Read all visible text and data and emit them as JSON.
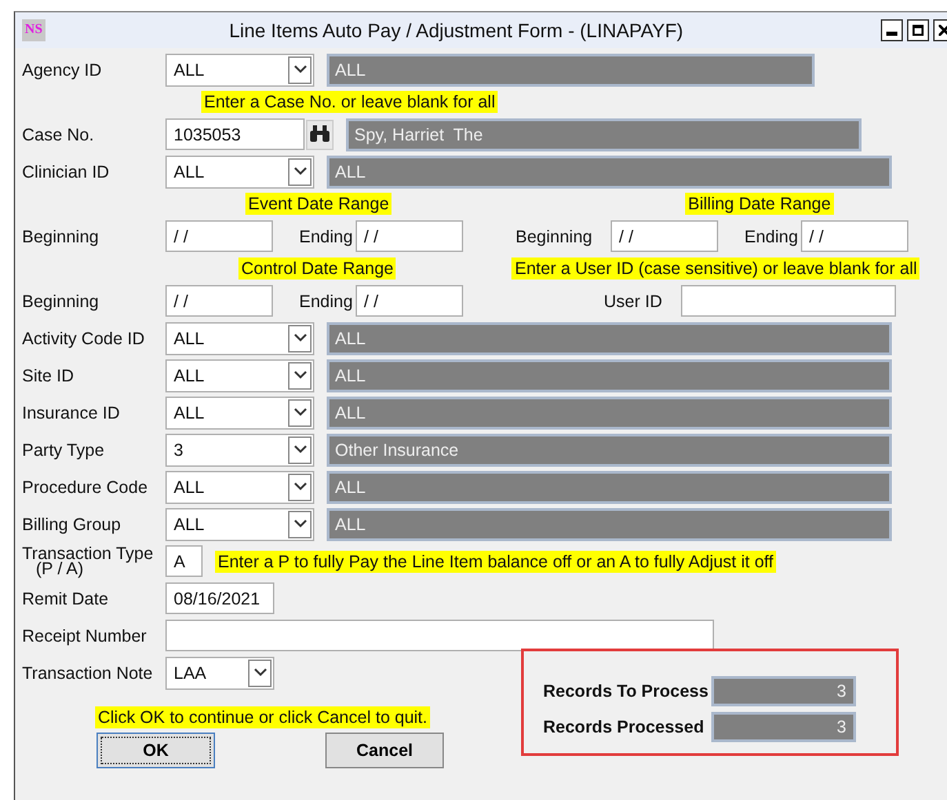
{
  "window": {
    "title": "Line Items Auto Pay / Adjustment Form - (LINAPAYF)",
    "logo": "NS"
  },
  "agency": {
    "label": "Agency ID",
    "value": "ALL",
    "description": "ALL"
  },
  "case_hint": "Enter a Case No. or leave blank for all",
  "case": {
    "label": "Case No.",
    "value": "1035053",
    "description": "Spy, Harriet  The"
  },
  "clinician": {
    "label": "Clinician ID",
    "value": "ALL",
    "description": "ALL"
  },
  "event_range": {
    "heading": "Event Date Range",
    "beginning_label": "Beginning",
    "beginning": " / /",
    "ending_label": "Ending",
    "ending": " / /"
  },
  "billing_range": {
    "heading": "Billing Date Range",
    "beginning_label": "Beginning",
    "beginning": " / /",
    "ending_label": "Ending",
    "ending": " / /"
  },
  "control_range": {
    "heading": "Control Date Range",
    "beginning_label": "Beginning",
    "beginning": " / /",
    "ending_label": "Ending",
    "ending": " / /"
  },
  "user_id": {
    "heading": "Enter a User ID (case sensitive) or leave blank for all",
    "label": "User ID"
  },
  "code_fields": [
    {
      "label": "Activity Code ID",
      "value": "ALL",
      "description": "ALL"
    },
    {
      "label": "Site ID",
      "value": "ALL",
      "description": "ALL"
    },
    {
      "label": "Insurance ID",
      "value": "ALL",
      "description": "ALL"
    },
    {
      "label": "Party Type",
      "value": "3",
      "description": "Other Insurance"
    },
    {
      "label": "Procedure Code",
      "value": "ALL",
      "description": "ALL"
    },
    {
      "label": "Billing Group",
      "value": "ALL",
      "description": "ALL"
    }
  ],
  "transaction_type": {
    "label": "Transaction Type",
    "sublabel": "(P / A)",
    "value": "A",
    "hint": "Enter a P to fully Pay the Line Item balance off or an A to fully Adjust it off"
  },
  "remit_date": {
    "label": "Remit Date",
    "value": "08/16/2021"
  },
  "receipt_number": {
    "label": "Receipt Number"
  },
  "transaction_note": {
    "label": "Transaction Note",
    "value": "LAA"
  },
  "footer_hint": "Click OK to continue or click Cancel to quit.",
  "buttons": [
    {
      "label": "OK",
      "default": true
    },
    {
      "label": "Cancel",
      "default": false
    }
  ],
  "totals": [
    {
      "label": "Records To Process",
      "value": "3"
    },
    {
      "label": "Records Processed",
      "value": "3"
    }
  ]
}
